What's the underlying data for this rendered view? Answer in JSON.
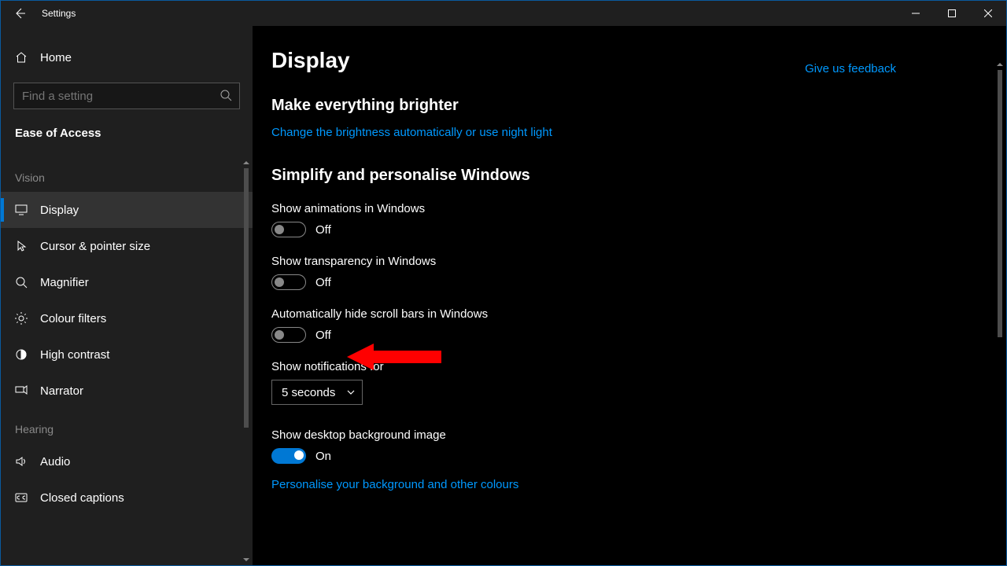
{
  "window": {
    "title": "Settings"
  },
  "sidebar": {
    "home": "Home",
    "search_placeholder": "Find a setting",
    "section": "Ease of Access",
    "groups": [
      {
        "label": "Vision",
        "items": [
          {
            "key": "display",
            "label": "Display",
            "selected": true,
            "icon": "monitor"
          },
          {
            "key": "cursor",
            "label": "Cursor & pointer size",
            "selected": false,
            "icon": "cursor"
          },
          {
            "key": "magnifier",
            "label": "Magnifier",
            "selected": false,
            "icon": "magnify"
          },
          {
            "key": "colour-filters",
            "label": "Colour filters",
            "selected": false,
            "icon": "brightness"
          },
          {
            "key": "high-contrast",
            "label": "High contrast",
            "selected": false,
            "icon": "contrast"
          },
          {
            "key": "narrator",
            "label": "Narrator",
            "selected": false,
            "icon": "narrator"
          }
        ]
      },
      {
        "label": "Hearing",
        "items": [
          {
            "key": "audio",
            "label": "Audio",
            "selected": false,
            "icon": "audio"
          },
          {
            "key": "closed-captions",
            "label": "Closed captions",
            "selected": false,
            "icon": "cc"
          }
        ]
      }
    ]
  },
  "content": {
    "title": "Display",
    "feedback": "Give us feedback",
    "section1": {
      "heading": "Make everything brighter",
      "link": "Change the brightness automatically or use night light"
    },
    "section2": {
      "heading": "Simplify and personalise Windows",
      "settings": {
        "animations": {
          "label": "Show animations in Windows",
          "state": "Off",
          "on": false
        },
        "transparency": {
          "label": "Show transparency in Windows",
          "state": "Off",
          "on": false
        },
        "hide_scroll": {
          "label": "Automatically hide scroll bars in Windows",
          "state": "Off",
          "on": false
        },
        "notifications": {
          "label": "Show notifications for",
          "value": "5 seconds"
        },
        "desktop_bg": {
          "label": "Show desktop background image",
          "state": "On",
          "on": true
        }
      },
      "personalise_link": "Personalise your background and other colours"
    }
  }
}
